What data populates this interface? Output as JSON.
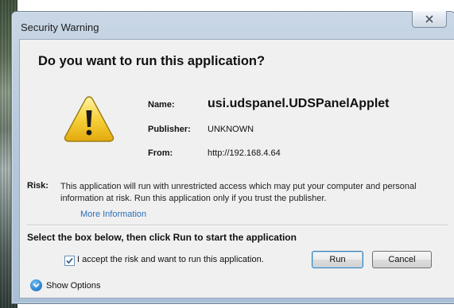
{
  "window": {
    "title": "Security Warning",
    "close_symbol": "✕"
  },
  "dialog": {
    "heading": "Do you want to run this application?",
    "icon": "warning-icon",
    "fields": {
      "name_label": "Name:",
      "name_value": "usi.udspanel.UDSPanelApplet",
      "publisher_label": "Publisher:",
      "publisher_value": "UNKNOWN",
      "from_label": "From:",
      "from_value": "http://192.168.4.64"
    },
    "risk": {
      "label": "Risk:",
      "text": "This application will run with unrestricted access which may put your computer and personal information at risk. Run this application only if you trust the publisher.",
      "more_info": "More Information"
    },
    "instruction": "Select the box below, then click Run to start the application",
    "accept_checkbox": {
      "label": "I accept the risk and want to run this application.",
      "checked": true
    },
    "buttons": {
      "run": "Run",
      "cancel": "Cancel"
    },
    "show_options": "Show Options"
  },
  "colors": {
    "link": "#2a6fb8",
    "warning_yellow": "#f7d13a",
    "accent_blue": "#2d86d2"
  }
}
